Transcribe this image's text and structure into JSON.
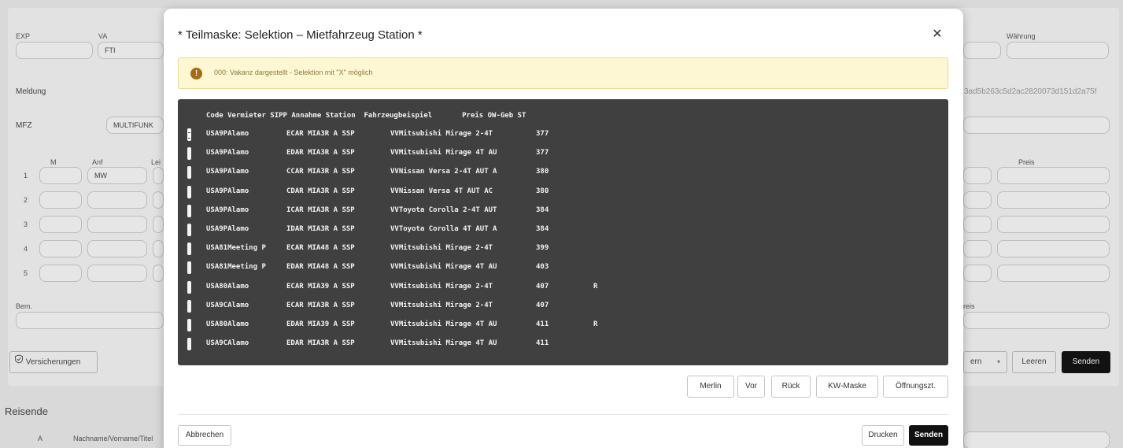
{
  "background": {
    "labels": {
      "exp": "EXP",
      "va": "VA",
      "waehrung": "Währung",
      "meldung": "Meldung",
      "mfz": "MFZ",
      "m": "M",
      "anf": "Anf",
      "lei": "Lei",
      "preis": "Preis",
      "bem": "Bem.",
      "preis_right": "reis",
      "row1": "1",
      "row2": "2",
      "row3": "3",
      "row4": "4",
      "row5": "5",
      "nachname": "Nachname/Vorname/Titel",
      "a": "A"
    },
    "va_value": "FTI",
    "mfz_value": "MULTIFUNK",
    "anf_value": "MW",
    "hash": "3ad5b263c5d2ac2820073d151d2a75f",
    "versicherungen": "Versicherungen",
    "right_select": "ern",
    "leeren": "Leeren",
    "senden": "Senden",
    "reisende": "Reisende"
  },
  "modal": {
    "title": "* Teilmaske: Selektion – Mietfahrzeug Station *",
    "warning": "000: Vakanz dargestellt - Selektion mit \"X\" möglich",
    "header": "Code Vermieter SIPP Annahme Station  Fahrzeugbeispiel       Preis OW-Geb ST",
    "rows": [
      {
        "code": "USA9PAlamo",
        "sipp": "ECAR MIA3R A SSP",
        "car": "VVMitsubishi Mirage 2-4T",
        "price": "377",
        "st": ""
      },
      {
        "code": "USA9PAlamo",
        "sipp": "EDAR MIA3R A SSP",
        "car": "VVMitsubishi Mirage 4T AU",
        "price": "377",
        "st": ""
      },
      {
        "code": "USA9PAlamo",
        "sipp": "CCAR MIA3R A SSP",
        "car": "VVNissan Versa 2-4T AUT A",
        "price": "380",
        "st": ""
      },
      {
        "code": "USA9PAlamo",
        "sipp": "CDAR MIA3R A SSP",
        "car": "VVNissan Versa 4T AUT AC",
        "price": "380",
        "st": ""
      },
      {
        "code": "USA9PAlamo",
        "sipp": "ICAR MIA3R A SSP",
        "car": "VVToyota Corolla 2-4T AUT",
        "price": "384",
        "st": ""
      },
      {
        "code": "USA9PAlamo",
        "sipp": "IDAR MIA3R A SSP",
        "car": "VVToyota Corolla 4T AUT A",
        "price": "384",
        "st": ""
      },
      {
        "code": "USA81Meeting P",
        "sipp": "ECAR MIA48 A SSP",
        "car": "VVMitsubishi Mirage 2-4T",
        "price": "399",
        "st": ""
      },
      {
        "code": "USA81Meeting P",
        "sipp": "EDAR MIA48 A SSP",
        "car": "VVMitsubishi Mirage 4T AU",
        "price": "403",
        "st": ""
      },
      {
        "code": "USA80Alamo",
        "sipp": "ECAR MIA39 A SSP",
        "car": "VVMitsubishi Mirage 2-4T",
        "price": "407",
        "st": "R"
      },
      {
        "code": "USA9CAlamo",
        "sipp": "ECAR MIA3R A SSP",
        "car": "VVMitsubishi Mirage 2-4T",
        "price": "407",
        "st": ""
      },
      {
        "code": "USA80Alamo",
        "sipp": "EDAR MIA39 A SSP",
        "car": "VVMitsubishi Mirage 4T AU",
        "price": "411",
        "st": "R"
      },
      {
        "code": "USA9CAlamo",
        "sipp": "EDAR MIA3R A SSP",
        "car": "VVMitsubishi Mirage 4T AU",
        "price": "411",
        "st": ""
      }
    ],
    "buttons": {
      "merlin": "Merlin",
      "vor": "Vor",
      "rueck": "Rück",
      "kw_maske": "KW-Maske",
      "oeffnungszeiten": "Öffnungszt."
    },
    "footer": {
      "abbrechen": "Abbrechen",
      "drucken": "Drucken",
      "senden": "Senden"
    }
  }
}
